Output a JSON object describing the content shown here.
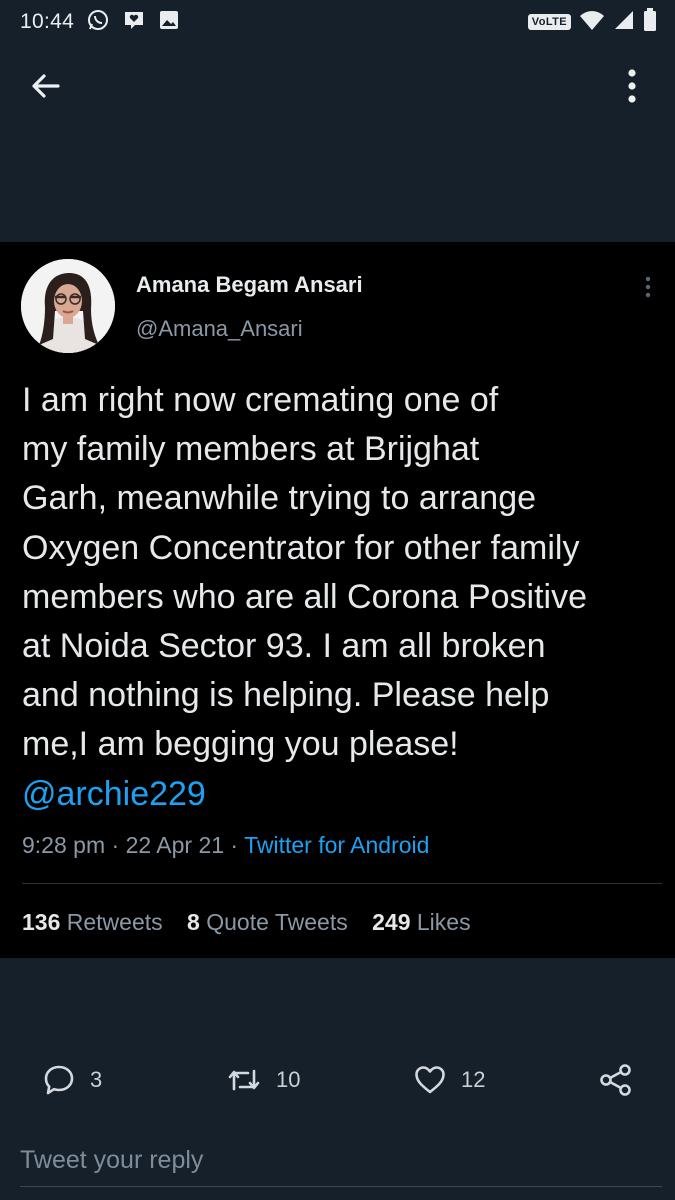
{
  "status_bar": {
    "time": "10:44",
    "network_badge": "VoLTE",
    "icons": [
      "whatsapp-icon",
      "heart-message-icon",
      "image-icon",
      "wifi-icon",
      "signal-icon",
      "battery-icon"
    ]
  },
  "app_bar": {
    "back_icon": "arrow-left-icon",
    "menu_icon": "more-vertical-icon"
  },
  "tweet": {
    "display_name": "Amana Begam Ansari",
    "handle": "@Amana_Ansari",
    "text_lines": [
      "I am right now cremating one of",
      "my family members at Brijghat",
      "Garh, meanwhile trying to arrange",
      "Oxygen Concentrator for other family",
      "members who are all Corona Positive",
      "at Noida Sector 93. I am all broken",
      "and nothing is helping. Please help",
      "me,I am begging you please!"
    ],
    "mention": "@archie229",
    "time": "9:28 pm",
    "date": "22 Apr 21",
    "source": "Twitter for Android",
    "separator": "·",
    "stats": {
      "retweets_count": "136",
      "retweets_label": "Retweets",
      "quotes_count": "8",
      "quotes_label": "Quote Tweets",
      "likes_count": "249",
      "likes_label": "Likes"
    }
  },
  "actions": {
    "reply_count": "3",
    "retweet_count": "10",
    "like_count": "12"
  },
  "reply": {
    "placeholder": "Tweet your reply"
  },
  "colors": {
    "background": "#15202b",
    "card": "#000000",
    "accent": "#1da1f2",
    "secondary_text": "#8b98a5"
  }
}
